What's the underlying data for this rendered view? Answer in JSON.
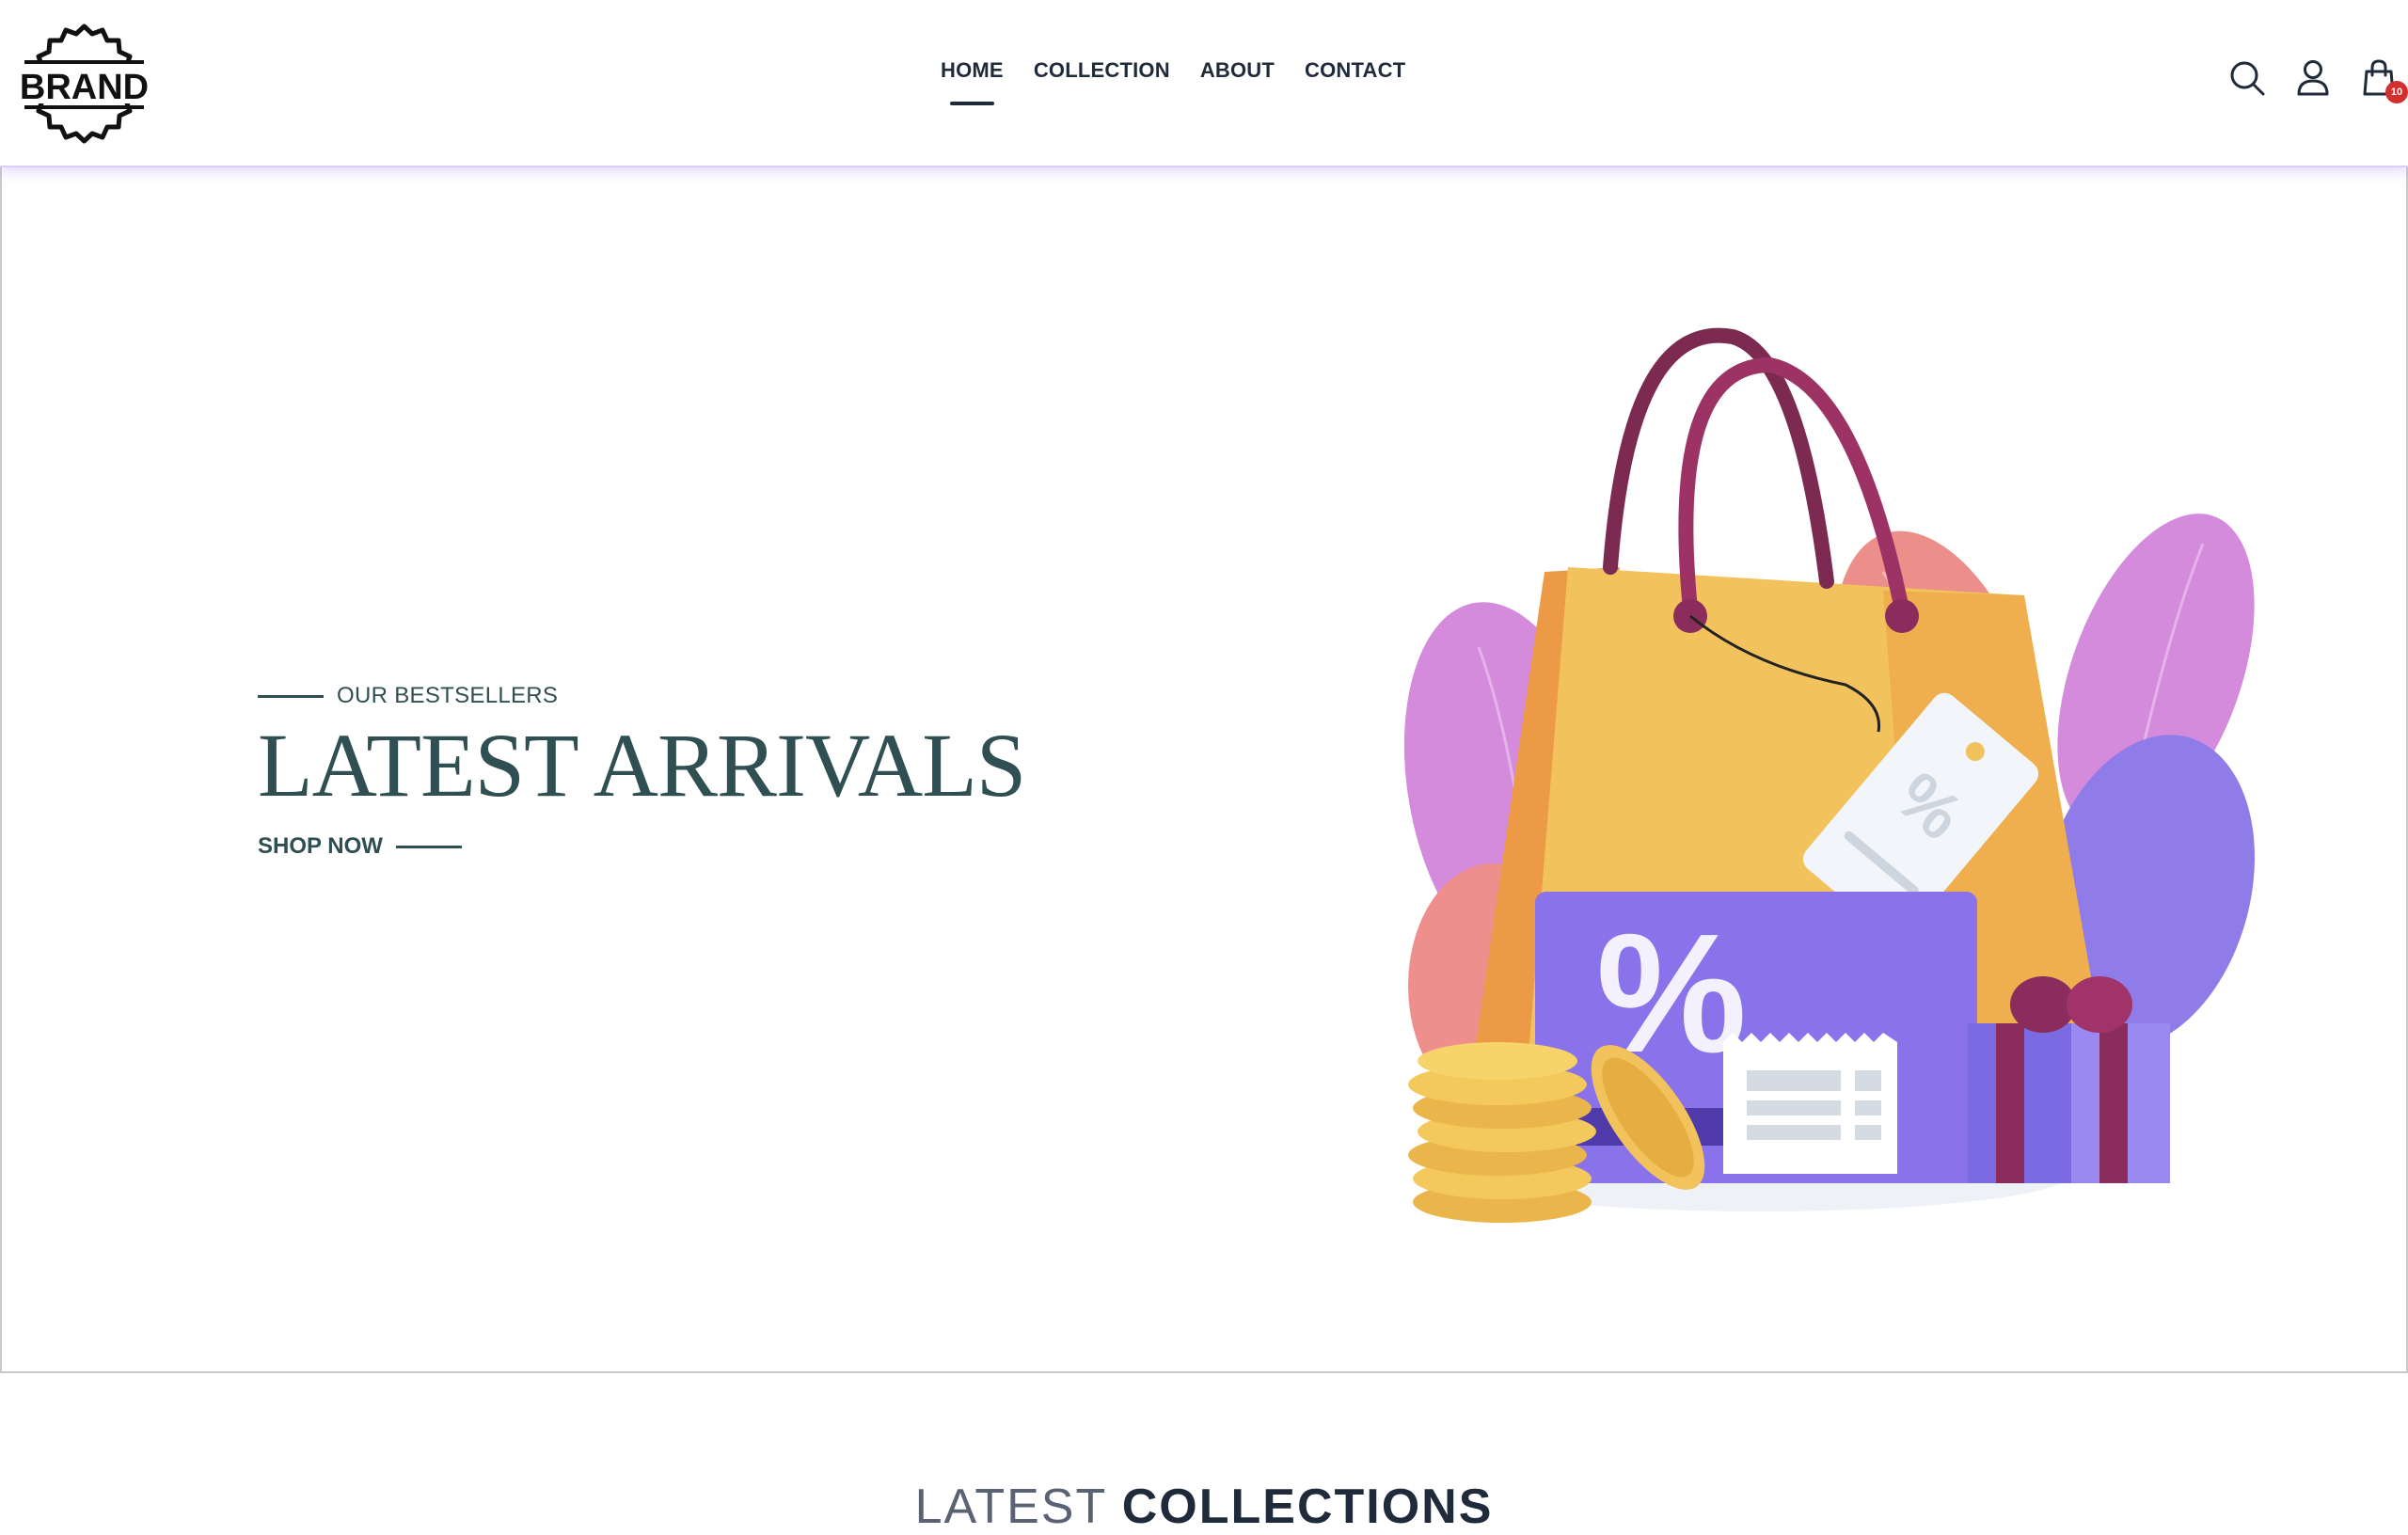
{
  "brand": {
    "logo_text": "BRAND",
    "logo_icon": "badge-logo-icon"
  },
  "nav": {
    "items": [
      {
        "label": "HOME",
        "active": true
      },
      {
        "label": "COLLECTION",
        "active": false
      },
      {
        "label": "ABOUT",
        "active": false
      },
      {
        "label": "CONTACT",
        "active": false
      }
    ]
  },
  "header_icons": {
    "search": "search-icon",
    "account": "user-icon",
    "cart": "shopping-bag-icon",
    "cart_count": "10"
  },
  "hero": {
    "eyebrow": "OUR BESTSELLERS",
    "title": "LATEST ARRIVALS",
    "cta": "SHOP NOW",
    "illustration": "shopping-bag-discount-illustration"
  },
  "collections": {
    "heading_light": "LATEST",
    "heading_bold": "COLLECTIONS"
  },
  "colors": {
    "text_primary": "#1f2a3a",
    "hero_text": "#2f4f52",
    "header_shadow": "#d8cef7",
    "badge": "#d32f2f",
    "bag_yellow": "#f2b84e",
    "handle": "#8b2d5c",
    "purple": "#8a6fe8",
    "pink": "#e08a8a"
  }
}
